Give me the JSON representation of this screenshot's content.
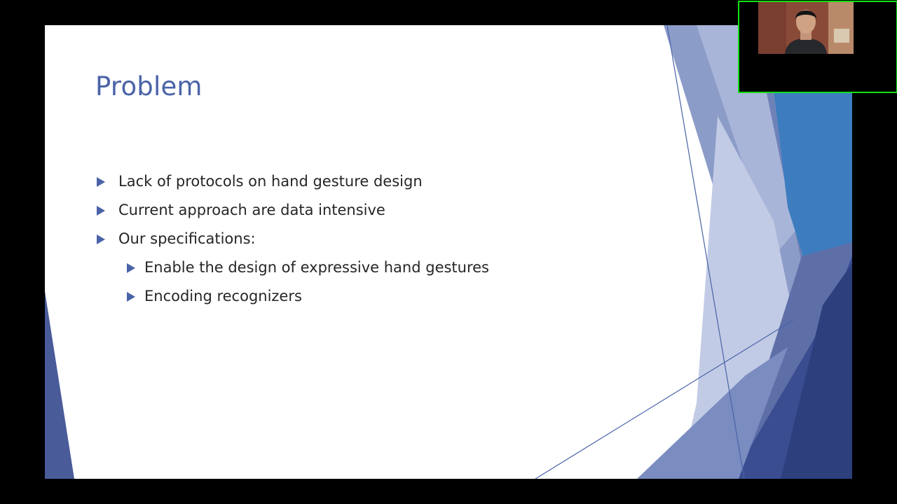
{
  "slide": {
    "title": "Problem",
    "bullets": [
      {
        "text": "Lack of protocols on hand gesture design",
        "level": 1
      },
      {
        "text": "Current approach are data intensive",
        "level": 1
      },
      {
        "text": "Our specifications:",
        "level": 1
      },
      {
        "text": "Enable the design of expressive hand gestures",
        "level": 2
      },
      {
        "text": "Encoding recognizers",
        "level": 2
      }
    ],
    "bullet_icon": "triangle-bullet-icon"
  },
  "colors": {
    "background": "#000000",
    "slide_background": "#ffffff",
    "title": "#4a63a8",
    "body_text": "#262626",
    "accent_dark": "#2e3f7e",
    "accent_mid": "#6a7fb4",
    "accent_light": "#b3bfdd",
    "webcam_border": "#13e013"
  },
  "webcam": {
    "icon": "webcam-video-feed"
  }
}
